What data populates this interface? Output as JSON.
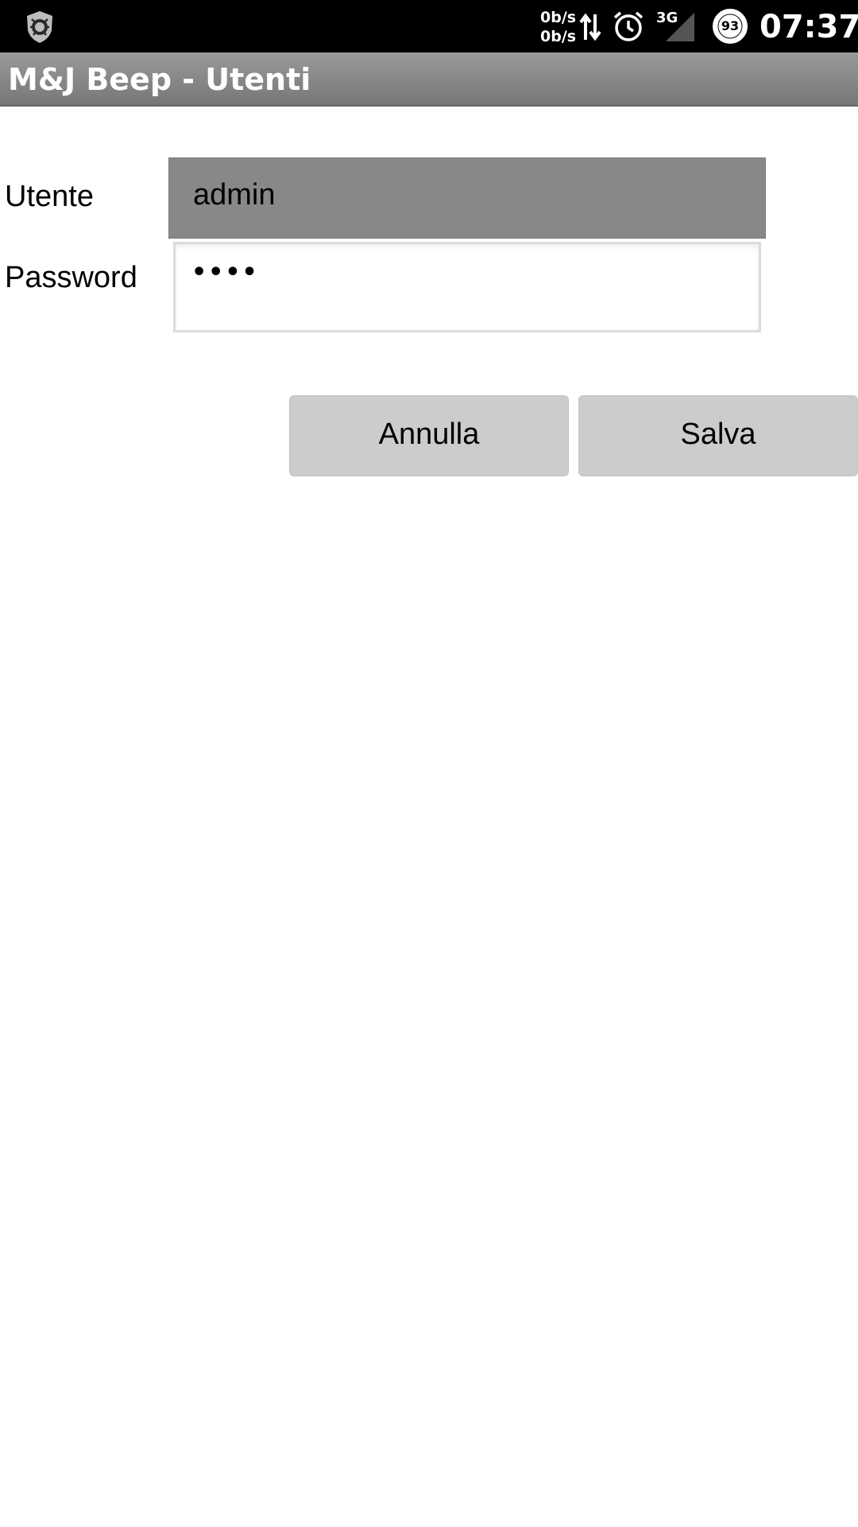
{
  "status_bar": {
    "net_speed_up": "0b/s",
    "net_speed_down": "0b/s",
    "network_type": "3G",
    "battery_level": "93",
    "time": "07:37",
    "icons": [
      "shield-app-icon",
      "data-arrows-icon",
      "alarm-icon",
      "signal-icon",
      "battery-icon"
    ]
  },
  "title_bar": {
    "title": "M&J Beep - Utenti"
  },
  "form": {
    "user_label": "Utente",
    "user_value": "admin",
    "password_label": "Password",
    "password_value": "••••"
  },
  "buttons": {
    "cancel_label": "Annulla",
    "save_label": "Salva"
  },
  "colors": {
    "status_bar": "#000000",
    "title_bar": "#888888",
    "user_field_bg": "#888888",
    "button_bg": "#cccccc"
  }
}
